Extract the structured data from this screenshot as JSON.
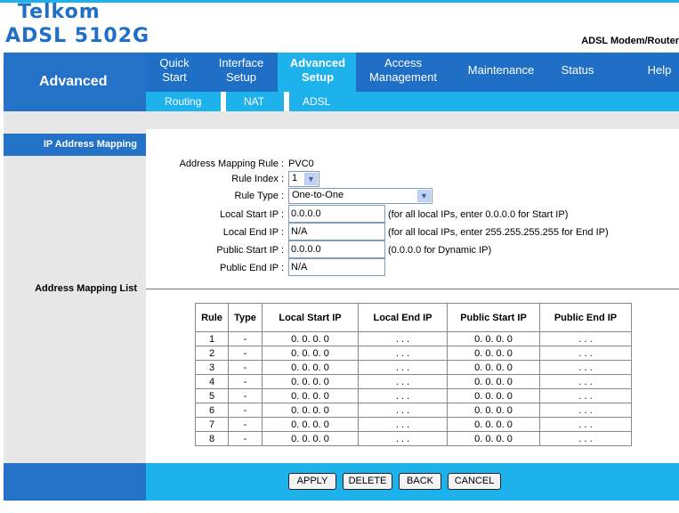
{
  "brand": {
    "line1": "Telkom",
    "line2": "ADSL 5102G",
    "product_type": "ADSL Modem/Router"
  },
  "nav": {
    "section": "Advanced",
    "tabs": [
      {
        "line1": "Quick",
        "line2": "Start"
      },
      {
        "line1": "Interface",
        "line2": "Setup"
      },
      {
        "line1": "Advanced",
        "line2": "Setup"
      },
      {
        "line1": "Access",
        "line2": "Management"
      },
      {
        "line1": "Maintenance"
      },
      {
        "line1": "Status"
      },
      {
        "line1": "Help"
      }
    ],
    "active_tab": "Advanced Setup",
    "subtabs": [
      "Routing",
      "NAT",
      "ADSL"
    ]
  },
  "section_title": "IP Address Mapping",
  "form": {
    "rule_label": "Address Mapping Rule :",
    "rule_value": "PVC0",
    "rule_index_label": "Rule Index :",
    "rule_index_value": "1",
    "rule_type_label": "Rule Type :",
    "rule_type_value": "One-to-One",
    "local_start_label": "Local Start IP :",
    "local_start_value": "0.0.0.0",
    "local_start_hint": "(for all local IPs, enter 0.0.0.0 for Start IP)",
    "local_end_label": "Local End IP :",
    "local_end_value": "N/A",
    "local_end_hint": "(for all local IPs, enter 255.255.255.255 for End IP)",
    "public_start_label": "Public Start IP :",
    "public_start_value": "0.0.0.0",
    "public_start_hint": "(0.0.0.0 for Dynamic IP)",
    "public_end_label": "Public End IP :",
    "public_end_value": "N/A"
  },
  "list_title": "Address Mapping List",
  "table": {
    "headers": [
      "Rule",
      "Type",
      "Local Start IP",
      "Local End IP",
      "Public Start IP",
      "Public End IP"
    ],
    "rows": [
      [
        "1",
        "-",
        "0. 0. 0. 0",
        ". . .",
        "0. 0. 0. 0",
        ". . ."
      ],
      [
        "2",
        "-",
        "0. 0. 0. 0",
        ". . .",
        "0. 0. 0. 0",
        ". . ."
      ],
      [
        "3",
        "-",
        "0. 0. 0. 0",
        ". . .",
        "0. 0. 0. 0",
        ". . ."
      ],
      [
        "4",
        "-",
        "0. 0. 0. 0",
        ". . .",
        "0. 0. 0. 0",
        ". . ."
      ],
      [
        "5",
        "-",
        "0. 0. 0. 0",
        ". . .",
        "0. 0. 0. 0",
        ". . ."
      ],
      [
        "6",
        "-",
        "0. 0. 0. 0",
        ". . .",
        "0. 0. 0. 0",
        ". . ."
      ],
      [
        "7",
        "-",
        "0. 0. 0. 0",
        ". . .",
        "0. 0. 0. 0",
        ". . ."
      ],
      [
        "8",
        "-",
        "0. 0. 0. 0",
        ". . .",
        "0. 0. 0. 0",
        ". . ."
      ]
    ]
  },
  "buttons": {
    "apply": "APPLY",
    "delete": "DELETE",
    "back": "BACK",
    "cancel": "CANCEL"
  },
  "colors": {
    "brand_blue": "#1f6fc6",
    "accent_cyan": "#1eb2ec",
    "panel_gray": "#e7e7e7"
  },
  "icons": {
    "dropdown": "chevron-down-icon"
  }
}
